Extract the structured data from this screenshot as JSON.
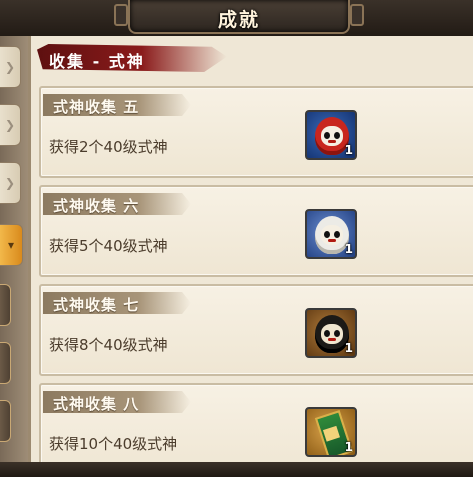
{
  "header": {
    "title": "成就"
  },
  "tabs": [
    {
      "icon": "chevron-right-icon",
      "state": "normal"
    },
    {
      "icon": "chevron-right-icon",
      "state": "normal"
    },
    {
      "icon": "chevron-right-icon",
      "state": "normal"
    },
    {
      "icon": "chevron-down-icon",
      "state": "active"
    }
  ],
  "section": {
    "title": "收集 - 式神"
  },
  "achievements": [
    {
      "title": "式神收集 五",
      "desc": "获得2个40级式神",
      "reward": {
        "icon": "red-daruma-icon",
        "qty": "1"
      }
    },
    {
      "title": "式神收集 六",
      "desc": "获得5个40级式神",
      "reward": {
        "icon": "white-daruma-icon",
        "qty": "1"
      }
    },
    {
      "title": "式神收集 七",
      "desc": "获得8个40级式神",
      "reward": {
        "icon": "black-daruma-icon",
        "qty": "1"
      }
    },
    {
      "title": "式神收集 八",
      "desc": "获得10个40级式神",
      "reward": {
        "icon": "charm-item-icon",
        "qty": "1"
      }
    }
  ],
  "colors": {
    "panel_bg": "#efe7d6",
    "section_banner": "#8a1b1b",
    "card_tag": "#a89579",
    "active_tab": "#f2b84a",
    "desc_text": "#4b3c2c"
  }
}
